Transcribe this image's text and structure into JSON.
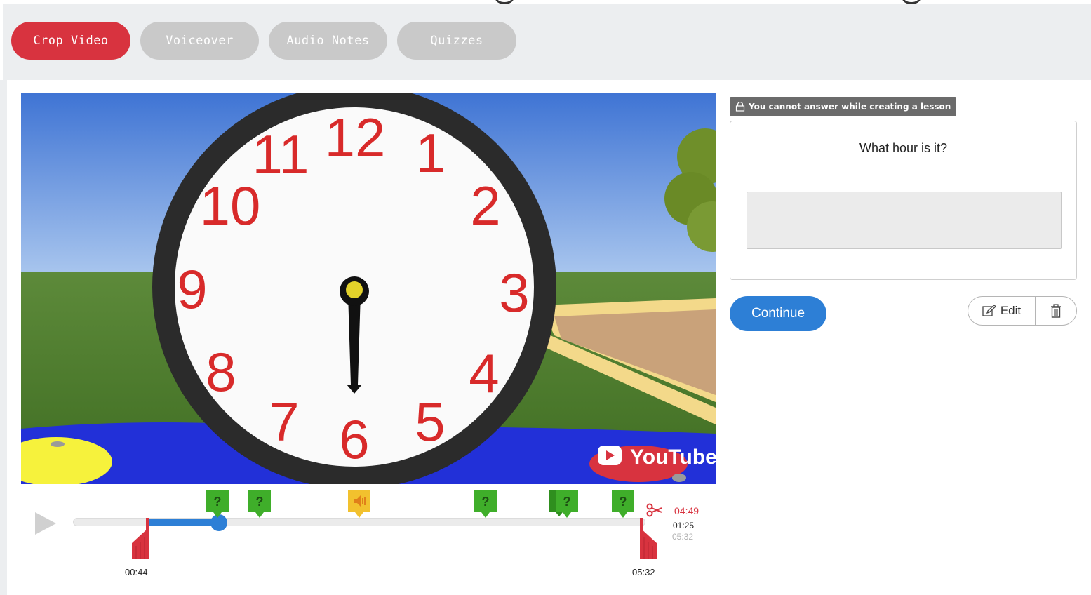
{
  "tabs": [
    {
      "label": "Crop Video",
      "active": true
    },
    {
      "label": "Voiceover",
      "active": false
    },
    {
      "label": "Audio Notes",
      "active": false
    },
    {
      "label": "Quizzes",
      "active": false
    }
  ],
  "video": {
    "clock_numbers": [
      "12",
      "1",
      "2",
      "3",
      "4",
      "5",
      "6",
      "7",
      "8",
      "9",
      "10",
      "11"
    ],
    "watermark": "YouTube"
  },
  "timeline": {
    "start_time": "00:44",
    "end_time": "05:32",
    "crop_end_time": "04:49",
    "current_time": "01:25",
    "total_time": "05:32",
    "quiz_marker_label": "?",
    "markers": [
      "quiz",
      "quiz",
      "audio-note",
      "quiz",
      "quiz",
      "quiz"
    ]
  },
  "quiz_panel": {
    "notice": "You cannot answer while creating a lesson",
    "question": "What hour is it?",
    "answer_value": "",
    "continue_label": "Continue",
    "edit_label": "Edit"
  },
  "colors": {
    "accent_red": "#d8333f",
    "accent_blue": "#2d7fd6",
    "quiz_marker_green": "#3fae2a",
    "audio_marker_yellow": "#f2c12e",
    "clock_numeral_red": "#d82a2a"
  }
}
